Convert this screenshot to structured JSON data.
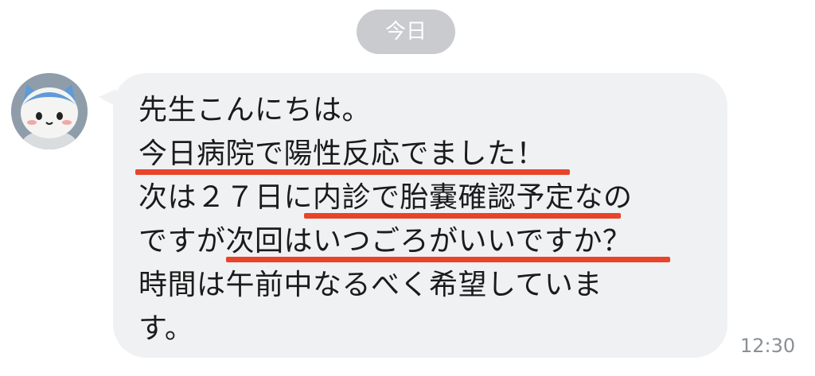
{
  "date_label": "今日",
  "avatar_icon": "cat-mascot-avatar",
  "message": {
    "lines": [
      "先生こんにちは。",
      "今日病院で陽性反応でました！",
      "次は２７日に内診で胎嚢確認予定なの",
      "ですが次回はいつごろがいいですか？",
      "時間は午前中なるべく希望していま",
      "す。"
    ],
    "highlight_color": "#e8442a"
  },
  "timestamp": "12:30"
}
